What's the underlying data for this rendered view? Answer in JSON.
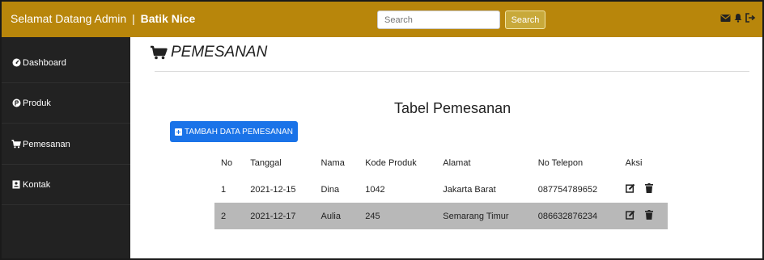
{
  "topbar": {
    "greeting": "Selamat Datang Admin",
    "separator": "|",
    "brand": "Batik Nice",
    "search_placeholder": "Search",
    "search_button": "Search",
    "icons": [
      "envelope-icon",
      "bell-icon",
      "sign-out-icon"
    ]
  },
  "sidebar": {
    "items": [
      {
        "label": "Dashboard",
        "icon": "dashboard-icon"
      },
      {
        "label": "Produk",
        "icon": "product-icon"
      },
      {
        "label": "Pemesanan",
        "icon": "cart-icon"
      },
      {
        "label": "Kontak",
        "icon": "contact-icon"
      }
    ]
  },
  "main": {
    "page_title": "PEMESANAN",
    "table_title": "Tabel Pemesanan",
    "add_button": "TAMBAH DATA PEMESANAN",
    "columns": [
      "No",
      "Tanggal",
      "Nama",
      "Kode Produk",
      "Alamat",
      "No Telepon",
      "Aksi"
    ],
    "rows": [
      {
        "no": "1",
        "tanggal": "2021-12-15",
        "nama": "Dina",
        "kode": "1042",
        "alamat": "Jakarta Barat",
        "telepon": "087754789652"
      },
      {
        "no": "2",
        "tanggal": "2021-12-17",
        "nama": "Aulia",
        "kode": "245",
        "alamat": "Semarang Timur",
        "telepon": "086632876234"
      }
    ]
  },
  "colors": {
    "topbar": "#b8860b",
    "sidebar": "#222222",
    "primary_button": "#1a73e8",
    "striped_row": "#b8b8b8"
  }
}
